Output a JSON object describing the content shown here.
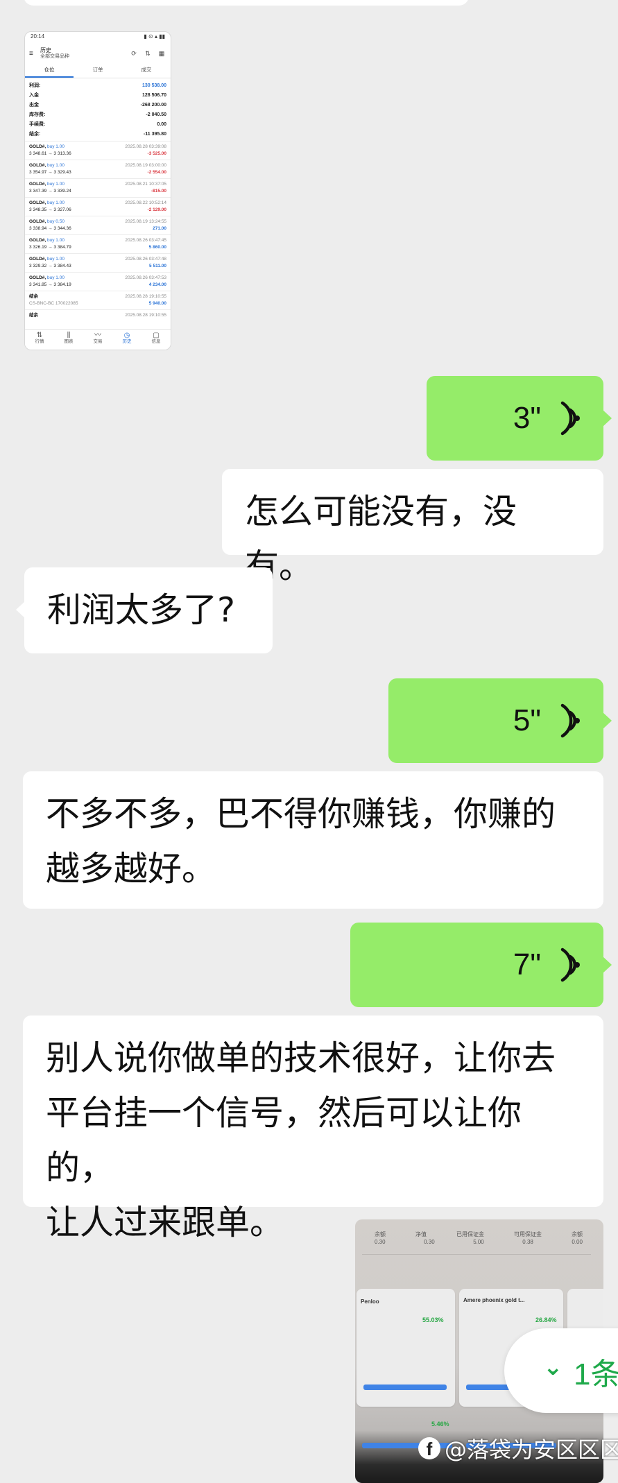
{
  "embedded_trading_screenshot": {
    "status_time": "20:14",
    "header_title": "历史",
    "header_subtitle": "全部交易品种",
    "tabs": [
      "仓位",
      "订单",
      "成交"
    ],
    "summary": [
      {
        "label": "利润:",
        "value": "130 538.00",
        "blue": true
      },
      {
        "label": "入金",
        "value": "128 506.70"
      },
      {
        "label": "出金",
        "value": "-268 200.00"
      },
      {
        "label": "库存费:",
        "value": "-2 040.50"
      },
      {
        "label": "手续费:",
        "value": "0.00"
      },
      {
        "label": "结余:",
        "value": "-11 395.80"
      }
    ],
    "trades": [
      {
        "symbol": "GOLD#,",
        "side": "buy 1.00",
        "prices": "3 348.61 → 3 313.36",
        "time": "2025.08.28 03:39:08",
        "profit": "-3 525.00",
        "neg": true
      },
      {
        "symbol": "GOLD#,",
        "side": "buy 1.00",
        "prices": "3 354.97 → 3 329.43",
        "time": "2025.08.19 03:00:00",
        "profit": "-2 554.00",
        "neg": true
      },
      {
        "symbol": "GOLD#,",
        "side": "buy 1.00",
        "prices": "3 347.39 → 3 339.24",
        "time": "2025.08.21 10:37:05",
        "profit": "-815.00",
        "neg": true
      },
      {
        "symbol": "GOLD#,",
        "side": "buy 1.00",
        "prices": "3 348.35 → 3 327.06",
        "time": "2025.08.22 10:52:14",
        "profit": "-2 129.00",
        "neg": true
      },
      {
        "symbol": "GOLD#,",
        "side": "buy 0.50",
        "prices": "3 338.94 → 3 344.36",
        "time": "2025.08.19 13:24:55",
        "profit": "271.00",
        "neg": false
      },
      {
        "symbol": "GOLD#,",
        "side": "buy 1.00",
        "prices": "3 326.19 → 3 384.79",
        "time": "2025.08.26 03:47:45",
        "profit": "5 860.00",
        "neg": false
      },
      {
        "symbol": "GOLD#,",
        "side": "buy 1.00",
        "prices": "3 329.32 → 3 384.43",
        "time": "2025.08.26 03:47:48",
        "profit": "5 511.00",
        "neg": false
      },
      {
        "symbol": "GOLD#,",
        "side": "buy 1.00",
        "prices": "3 341.85 → 3 384.19",
        "time": "2025.08.26 03:47:53",
        "profit": "4 234.00",
        "neg": false
      }
    ],
    "balance_rows": [
      {
        "label": "结余",
        "note": "CS-BNC-BC 170022085",
        "time": "2025.08.28 19:10:55",
        "amount": "5 940.00"
      },
      {
        "label": "结余",
        "note": "",
        "time": "2025.08.28 19:10:55",
        "amount": ""
      }
    ],
    "nav": [
      "行情",
      "图表",
      "交易",
      "历史",
      "信息"
    ]
  },
  "messages": {
    "voice_1": "3\"",
    "text_1": "怎么可能没有，没有。",
    "text_2": "利润太多了?",
    "voice_2": "5\"",
    "text_3": "不多不多，巴不得你赚钱，你赚的\n越多越好。",
    "voice_3": "7\"",
    "text_4": "别人说你做单的技术很好，让你去\n平台挂一个信号，然后可以让你的，\n让人过来跟单。"
  },
  "photo": {
    "top_labels": [
      "余额",
      "净值",
      "已用保证金",
      "可用保证金",
      "余额"
    ],
    "top_values": [
      "0.30",
      "0.30",
      "5.00",
      "0.38",
      "0.00"
    ],
    "card_title": "Amere phoenix gold t...",
    "card_user": "Penloo",
    "pct_1": "55.03%",
    "pct_2": "26.84%",
    "pct_3": "5.46%"
  },
  "new_message_pill": {
    "count": "1条"
  },
  "watermark": {
    "text": "@落袋为安区区区",
    "logo": "f"
  }
}
